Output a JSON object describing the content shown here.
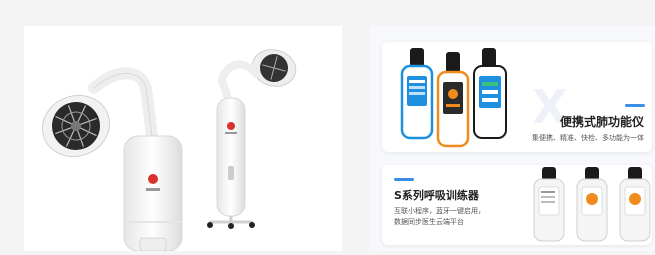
{
  "colors": {
    "accent": "#3a8ee6",
    "device_orange": "#f08c1e",
    "device_blue": "#1f8fe0",
    "brand_red": "#d9312b"
  },
  "left_panel": {
    "devices": [
      {
        "name": "lamp-device-1",
        "icon": "therapy-lamp-icon"
      },
      {
        "name": "lamp-device-2",
        "icon": "therapy-lamp-icon"
      }
    ]
  },
  "spirometer_card": {
    "title": "便携式肺功能仪",
    "subtitle": "集便携、精准、快检、多功能为一体"
  },
  "trainer_card": {
    "title": "S系列呼吸训练器",
    "desc_line1": "互联小程序，蓝牙一键启用，",
    "desc_line2": "数据同步医生云端平台"
  }
}
